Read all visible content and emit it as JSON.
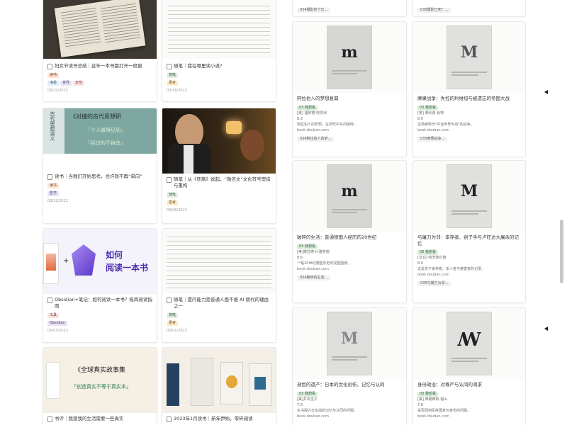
{
  "left_cards": [
    {
      "title": "妇女节读书总结｜这年一本书都打开一扇窗",
      "tags": [
        {
          "text": "读书",
          "bg": "#fbe4d3",
          "fg": "#6b3a1a"
        },
        {
          "text": "书单",
          "bg": "#e2ecf5",
          "fg": "#2a4a6b"
        },
        {
          "text": "世界",
          "bg": "#e8e2f3",
          "fg": "#4a3b6e"
        },
        {
          "text": "女性",
          "bg": "#fbe4e4",
          "fg": "#7a2a2a"
        }
      ],
      "date": "03/22/2023"
    },
    {
      "title": "随笔｜我在哪里读小说?",
      "tags": [
        {
          "text": "随笔",
          "bg": "#e3efe3",
          "fg": "#2c5e3c"
        },
        {
          "text": "思考",
          "bg": "#fdecc8",
          "fg": "#6b4a0a"
        }
      ],
      "date": "03/16/2023"
    },
    {
      "title": "读书｜当我们开始思考，也许就不再“单向”",
      "tags": [
        {
          "text": "读书",
          "bg": "#fbe4d3",
          "fg": "#6b3a1a"
        },
        {
          "text": "哲学",
          "bg": "#e8e2f3",
          "fg": "#4a3b6e"
        }
      ],
      "date": "03/12/2023"
    },
    {
      "title": "随笔｜从《狂飙》说起，“微信文”文化符号塑造与重构",
      "tags": [
        {
          "text": "随笔",
          "bg": "#e3efe3",
          "fg": "#2c5e3c"
        },
        {
          "text": "思考",
          "bg": "#fdecc8",
          "fg": "#6b4a0a"
        }
      ],
      "date": "03/06/2023"
    },
    {
      "title": "Obsidian+笔记：如何阅读一本书？极简阅读指南",
      "tags": [
        {
          "text": "工具",
          "bg": "#fbe4e4",
          "fg": "#7a2a2a"
        },
        {
          "text": "Obsidian",
          "bg": "#e8e2f3",
          "fg": "#4a3b6e"
        }
      ],
      "date": "03/03/2023"
    },
    {
      "title": "随笔｜提问能力是普通人面不被 AI 替代的理由之一",
      "tags": [
        {
          "text": "随笔",
          "bg": "#e3efe3",
          "fg": "#2c5e3c"
        },
        {
          "text": "思考",
          "bg": "#fdecc8",
          "fg": "#6b4a0a"
        }
      ],
      "date": "03/01/2023"
    },
    {
      "title": "书评｜我想我的生活需要一些真实",
      "tags": [],
      "date": ""
    },
    {
      "title": "2023年1月读书｜新年伊始，零碎阅读",
      "tags": [],
      "date": ""
    }
  ],
  "left_extra": {
    "cover2_title_line1": "《对撞的古代思想研",
    "cover2_title_line2": "「个人微博见到」",
    "cover2_title_line3": "「经过的不自由」",
    "cover2_side": "古代思想讲义",
    "cover3_title_line1": "如何",
    "cover3_title_line2": "阅读一本书",
    "cover3_plus": "+",
    "cover7_title_line1": "《全球真实故事集",
    "cover7_title_line2": "「创造真实不等于真实本」"
  },
  "right_cards": [
    {
      "title": "阿拉伯人的梦想复興",
      "badge": "03 我想看",
      "author": "[美] 福阿德·阿贾米",
      "rating": "8.3",
      "desc": "阿拉伯人的梦想，在现代中东的破碎。",
      "link": "book.douban.com",
      "chip": "034阿拉伯人的梦...",
      "logo": "m"
    },
    {
      "title": "摩果战争：失控的利维坦与被遗忘的帝国大战",
      "badge": "03 我想看",
      "author": "[英] 菲利普·肖特",
      "rating": "8.9",
      "desc": "这场被称为\"中亚世界大战\"的战争。",
      "link": "book.douban.com",
      "chip": "035摩果战争...",
      "logo": "M"
    },
    {
      "title": "破碎的生活：普通德国人经历的20世纪",
      "badge": "03 我想看",
      "author": "[美]康拉德·H·雅劳施",
      "rating": "8.6",
      "desc": "一幅20世纪德国历史的完整图景。",
      "link": "book.douban.com",
      "chip": "034破碎的生活...",
      "logo": "m"
    },
    {
      "title": "与屠刀为邻：幸存者、刽子手与卢旺达大屠杀的记忆",
      "badge": "03 我想看",
      "author": "[法]让·哈茨菲尔德",
      "rating": "8.9",
      "desc": "这是关于幸存者、杀人者与被害者的记录。",
      "link": "book.douban.com",
      "chip": "035与屠刀为邻...",
      "logo": "M"
    },
    {
      "title": "濒危的遗产：日本的文化创伤、记忆与认同",
      "badge": "03 我想看",
      "author": "[美]井本圭子",
      "rating": "7.9",
      "desc": "本书探讨日本战后记忆与认同的问题。",
      "link": "book.douban.com",
      "chip": "",
      "logo": "M"
    },
    {
      "title": "身份政治：对尊严与认同的渴求",
      "badge": "03 我想看",
      "author": "[美] 弗朗西斯·福山",
      "rating": "7.8",
      "desc": "是否回到民族国家与身份的问题。",
      "link": "book.douban.com",
      "chip": "",
      "logo": "ꟿ"
    }
  ],
  "right_top_chips": [
    "034摄影的十亿...",
    "035摄影已死？..."
  ],
  "colors": {
    "border": "#e9e9e7",
    "text": "#37352f",
    "muted": "#9b9a97",
    "scroll_thumb": "#c7c7c5"
  }
}
